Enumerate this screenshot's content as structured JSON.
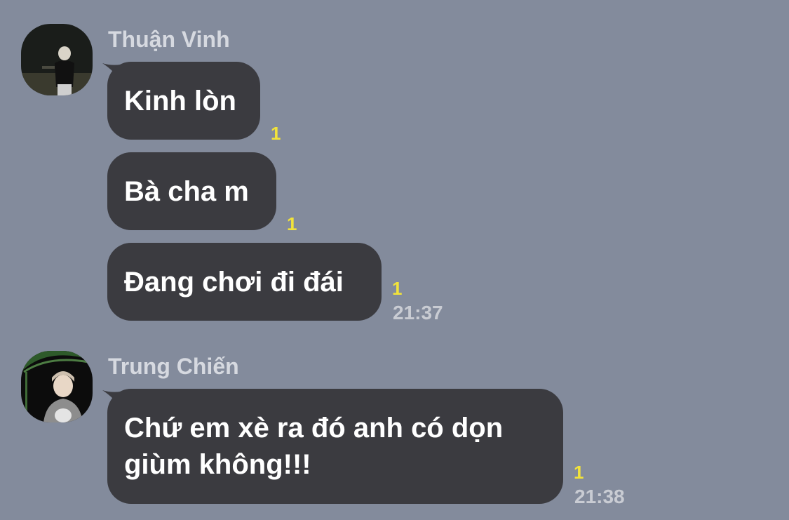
{
  "chat": {
    "groups": [
      {
        "sender": "Thuận Vinh",
        "avatar_icon": "person-photo-avatar",
        "messages": [
          {
            "text": "Kinh lòn",
            "unread": "1"
          },
          {
            "text": "Bà cha m",
            "unread": "1"
          },
          {
            "text": "Đang chơi đi đái",
            "unread": "1",
            "time": "21:37"
          }
        ]
      },
      {
        "sender": "Trung Chiến",
        "avatar_icon": "person-photo-avatar",
        "messages": [
          {
            "text_line1": "Chứ em xè ra đó anh có dọn",
            "text_line2": "giùm không!!!",
            "unread": "1",
            "time": "21:38"
          }
        ]
      }
    ]
  },
  "colors": {
    "background": "#838b9c",
    "bubble": "#3b3b40",
    "unread": "#f2e33a"
  }
}
